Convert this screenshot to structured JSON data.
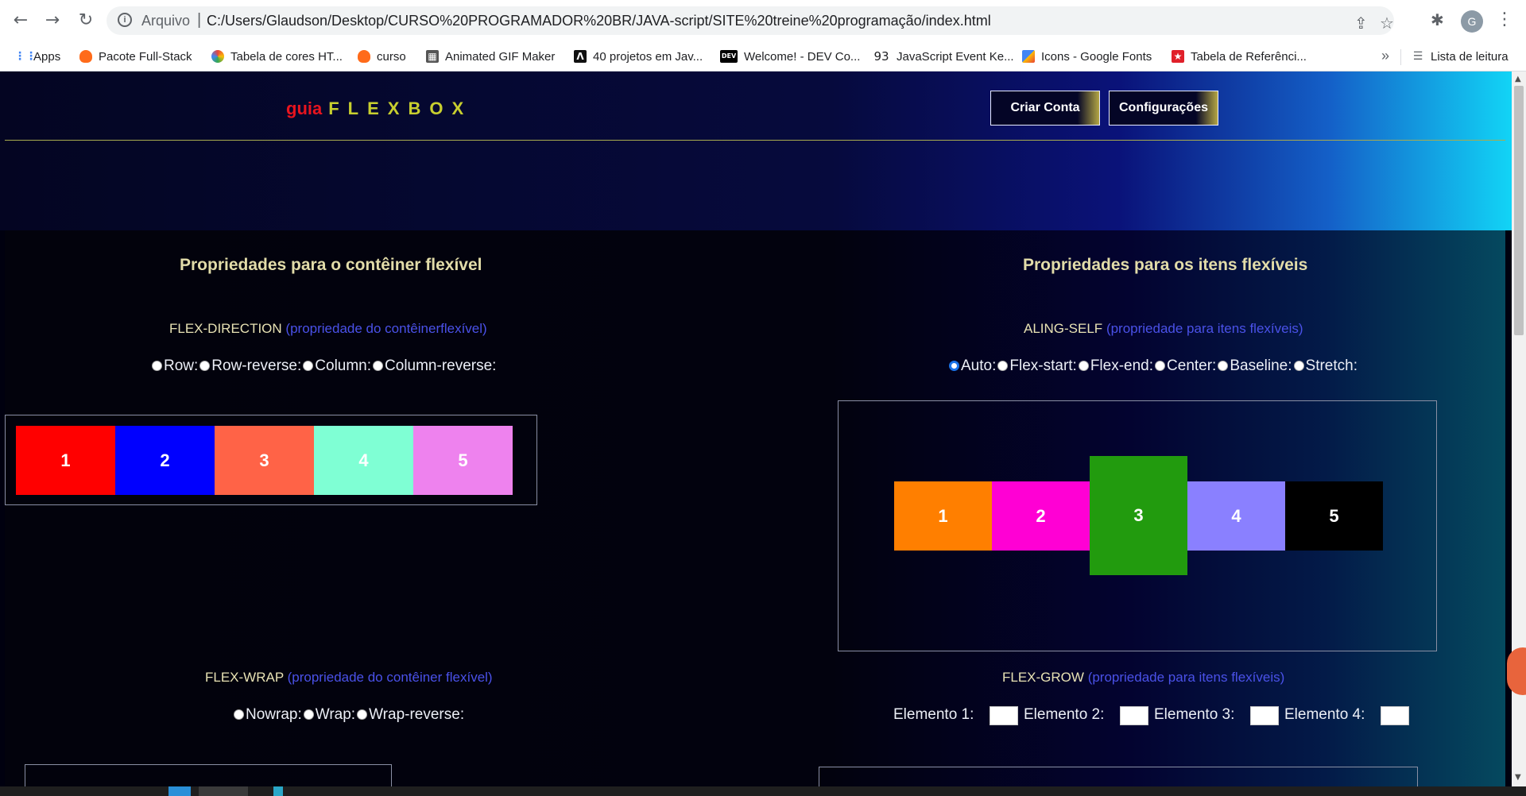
{
  "browser": {
    "scheme_label": "Arquivo",
    "separator": "|",
    "url": "C:/Users/Glaudson/Desktop/CURSO%20PROGRAMADOR%20BR/JAVA-script/SITE%20treine%20programação/index.html",
    "profile_initial": "G",
    "bookmarks": [
      {
        "label": "Apps",
        "icon": "apps-grid-icon",
        "color": "#4285f4"
      },
      {
        "label": "Pacote Full-Stack",
        "icon": "flame-icon",
        "color": "#ff6b1a"
      },
      {
        "label": "Tabela de cores HT...",
        "icon": "color-wheel-icon",
        "color": "#e8453c"
      },
      {
        "label": "curso",
        "icon": "flame-icon",
        "color": "#ff6b1a"
      },
      {
        "label": "Animated GIF Maker",
        "icon": "gif-maker-icon",
        "color": "#555555"
      },
      {
        "label": "40 projetos em Jav...",
        "icon": "code-logo-icon",
        "color": "#111111"
      },
      {
        "label": "Welcome! - DEV Co...",
        "icon": "dev-logo-icon",
        "color": "#000000"
      },
      {
        "label": "JavaScript Event Ke...",
        "icon": "number-93-icon",
        "color": "#ffffff"
      },
      {
        "label": "Icons - Google Fonts",
        "icon": "google-fonts-icon",
        "color": "#4285f4"
      },
      {
        "label": "Tabela de Referênci...",
        "icon": "star-badge-icon",
        "color": "#e0202a"
      }
    ],
    "bookmark_93": "93",
    "bm_dev": "DEV",
    "more_label": "»",
    "reading_list": "Lista de leitura"
  },
  "header": {
    "logo_guia": "guia",
    "logo_flexbox": "FLEXBOX",
    "btn_create": "Criar Conta",
    "btn_settings": "Configurações"
  },
  "left": {
    "title": "Propriedades para o contêiner flexível",
    "flex_direction": {
      "name": "FLEX-DIRECTION",
      "desc": "(propriedade do contêinerflexível)",
      "options": [
        "Row:",
        "Row-reverse:",
        "Column:",
        "Column-reverse:"
      ],
      "items": [
        "1",
        "2",
        "3",
        "4",
        "5"
      ]
    },
    "flex_wrap": {
      "name": "FLEX-WRAP",
      "desc": "(propriedade do contêiner flexível)",
      "options": [
        "Nowrap:",
        "Wrap:",
        "Wrap-reverse:"
      ]
    }
  },
  "right": {
    "title": "Propriedades para os itens flexíveis",
    "align_self": {
      "name": "ALING-SELF",
      "desc": "(propriedade para itens flexíveis)",
      "options": [
        "Auto:",
        "Flex-start:",
        "Flex-end:",
        "Center:",
        "Baseline:",
        "Stretch:"
      ],
      "selected": "Auto:",
      "items": [
        "1",
        "2",
        "3",
        "4",
        "5"
      ]
    },
    "flex_grow": {
      "name": "FLEX-GROW",
      "desc": "(propriedade para itens flexíveis)",
      "labels": [
        "Elemento 1:",
        "Elemento 2:",
        "Elemento 3:",
        "Elemento 4:"
      ]
    }
  },
  "colors": {
    "direction_items": [
      "#ff0000",
      "#0000ff",
      "#ff6347",
      "#7fffd4",
      "#ee82ee"
    ],
    "align_items": [
      "#ff7f00",
      "#ff00d4",
      "#229b0e",
      "#8a80ff",
      "#000000"
    ]
  }
}
